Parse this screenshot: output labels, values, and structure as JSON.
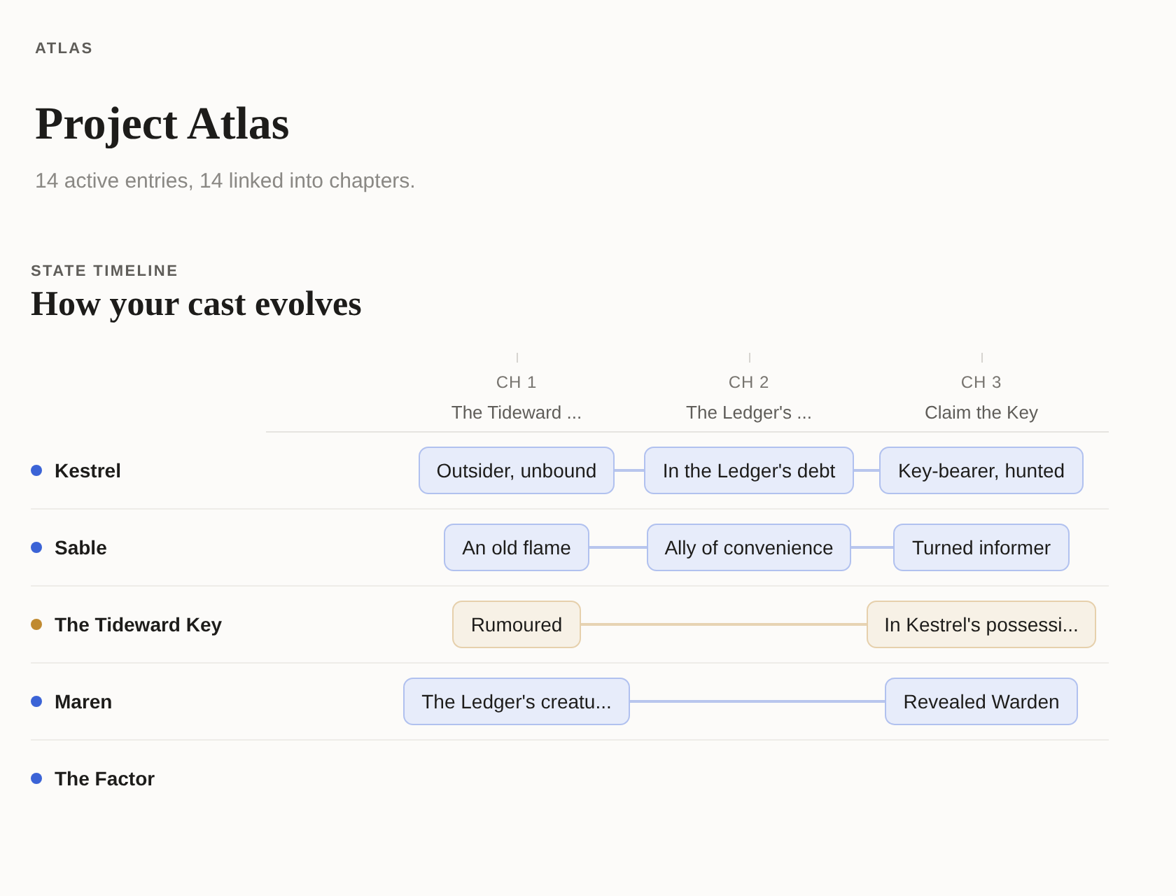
{
  "project": {
    "eyebrow": "ATLAS",
    "title": "Project Atlas",
    "summary": "14 active entries, 14 linked into chapters."
  },
  "timeline": {
    "eyebrow": "STATE TIMELINE",
    "title": "How your cast evolves",
    "chapters": [
      {
        "number": "CH 1",
        "title": "The Tideward ..."
      },
      {
        "number": "CH 2",
        "title": "The Ledger's ..."
      },
      {
        "number": "CH 3",
        "title": "Claim the Key"
      }
    ],
    "rows": [
      {
        "name": "Kestrel",
        "color": "#3b63d6",
        "cells": [
          {
            "state": "Outsider, unbound"
          },
          {
            "state": "In the Ledger's debt"
          },
          {
            "state": "Key-bearer, hunted"
          }
        ]
      },
      {
        "name": "Sable",
        "color": "#3b63d6",
        "cells": [
          {
            "state": "An old flame"
          },
          {
            "state": "Ally of convenience"
          },
          {
            "state": "Turned informer"
          }
        ]
      },
      {
        "name": "The Tideward Key",
        "color": "#c08a30",
        "cells": [
          {
            "state": "Rumoured"
          },
          {},
          {
            "state": "In Kestrel's possessi..."
          }
        ]
      },
      {
        "name": "Maren",
        "color": "#3b63d6",
        "cells": [
          {
            "state": "The Ledger's creatu..."
          },
          {},
          {
            "state": "Revealed Warden"
          }
        ]
      },
      {
        "name": "The Factor",
        "color": "#3b63d6"
      }
    ]
  }
}
